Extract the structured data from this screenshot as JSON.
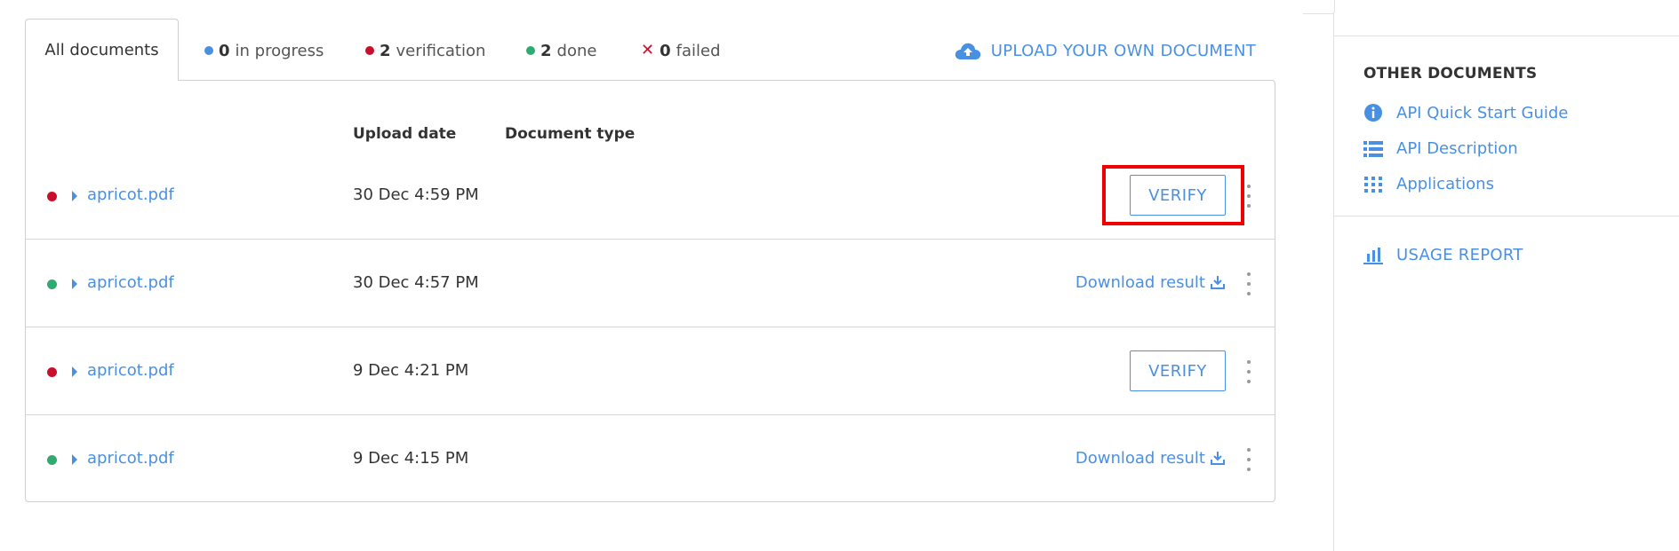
{
  "tabs": {
    "all": "All documents",
    "in_progress": {
      "count": "0",
      "label": "in progress"
    },
    "verification": {
      "count": "2",
      "label": "verification"
    },
    "done": {
      "count": "2",
      "label": "done"
    },
    "failed": {
      "count": "0",
      "label": "failed"
    }
  },
  "upload_label": "UPLOAD YOUR OWN DOCUMENT",
  "columns": {
    "upload_date": "Upload date",
    "document_type": "Document type"
  },
  "rows": [
    {
      "status": "verification",
      "status_color": "#c8102e",
      "filename": "apricot.pdf",
      "date": "30 Dec 4:59 PM",
      "action": "VERIFY"
    },
    {
      "status": "done",
      "status_color": "#2fab72",
      "filename": "apricot.pdf",
      "date": "30 Dec 4:57 PM",
      "action": "Download result"
    },
    {
      "status": "verification",
      "status_color": "#c8102e",
      "filename": "apricot.pdf",
      "date": "9 Dec 4:21 PM",
      "action": "VERIFY"
    },
    {
      "status": "done",
      "status_color": "#2fab72",
      "filename": "apricot.pdf",
      "date": "9 Dec 4:15 PM",
      "action": "Download result"
    }
  ],
  "sidebar": {
    "heading": "OTHER DOCUMENTS",
    "links": [
      {
        "label": "API Quick Start Guide",
        "icon": "info-icon"
      },
      {
        "label": "API Description",
        "icon": "list-icon"
      },
      {
        "label": "Applications",
        "icon": "grid-icon"
      }
    ],
    "usage_report": {
      "label": "USAGE REPORT",
      "icon": "bar-chart-icon"
    }
  },
  "colors": {
    "accent": "#4a90e2",
    "red": "#c8102e",
    "green": "#2fab72",
    "blue": "#4a90e2",
    "highlight": "#ee0000"
  }
}
